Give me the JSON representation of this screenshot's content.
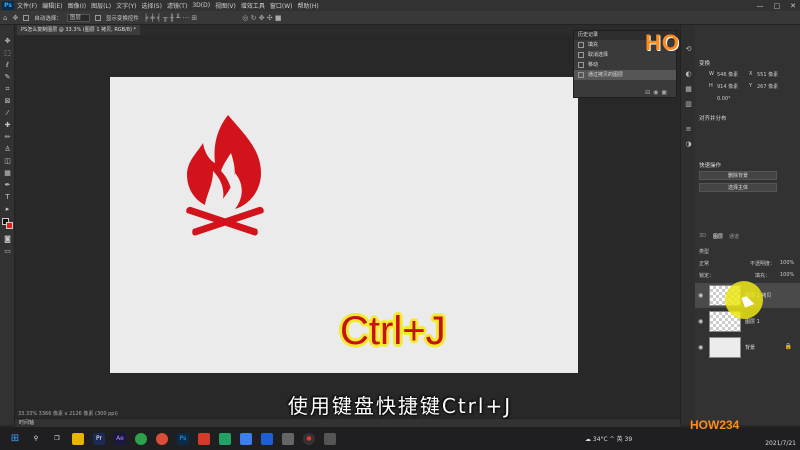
{
  "app": {
    "logo": "Ps",
    "menu": [
      "文件(F)",
      "编辑(E)",
      "图像(I)",
      "图层(L)",
      "文字(Y)",
      "选择(S)",
      "滤镜(T)",
      "3D(D)",
      "视图(V)",
      "增效工具",
      "窗口(W)",
      "帮助(H)"
    ],
    "window_controls": [
      "—",
      "□",
      "✕"
    ]
  },
  "options": {
    "auto_select_label": "自动选择：",
    "auto_select_value": "图层",
    "show_transform_label": "显示变换控件"
  },
  "document": {
    "tab_title": "PS怎么复制图层 @ 33.3% (图层 1 拷贝, RGB/8) *",
    "canvas_text": "Ctrl+J",
    "status": "33.33%    3366 像素 x 2126 像素 (300 ppi)",
    "timeline": "时间轴"
  },
  "history": {
    "title": "历史记录",
    "items": [
      "填充",
      "取消选择",
      "移动",
      "通过拷贝的图层"
    ],
    "selected_index": 3
  },
  "properties": {
    "section_transform": "变换",
    "w_label": "W",
    "w_value": "546 像素",
    "h_label": "H",
    "h_value": "914 像素",
    "x_label": "X",
    "x_value": "551 像素",
    "y_label": "Y",
    "y_value": "267 像素",
    "angle_value": "0.00°",
    "section_align": "对齐并分布",
    "section_quick": "快速操作",
    "btn_remove_bg": "删除背景",
    "btn_select_subject": "选择主体"
  },
  "layers": {
    "tabs": [
      "3D",
      "图层",
      "通道"
    ],
    "kind_label": "类型",
    "blend_mode": "正常",
    "opacity_label": "不透明度：",
    "opacity_value": "100%",
    "lock_label": "锁定：",
    "fill_label": "填充：",
    "fill_value": "100%",
    "items": [
      {
        "name": "图层 1 拷贝",
        "selected": true
      },
      {
        "name": "图层 1",
        "selected": false
      },
      {
        "name": "背景",
        "selected": false
      }
    ]
  },
  "subtitle": "使用键盘快捷键Ctrl+J",
  "watermark": "HOW234",
  "taskbar": {
    "temperature": "34°C",
    "input_indicator": "英",
    "volume_icon_count": "39",
    "date": "2021/7/21"
  },
  "colors": {
    "accent_red": "#c8101a",
    "highlight_yellow": "#f2ea2c",
    "ps_blue": "#31a8ff"
  }
}
